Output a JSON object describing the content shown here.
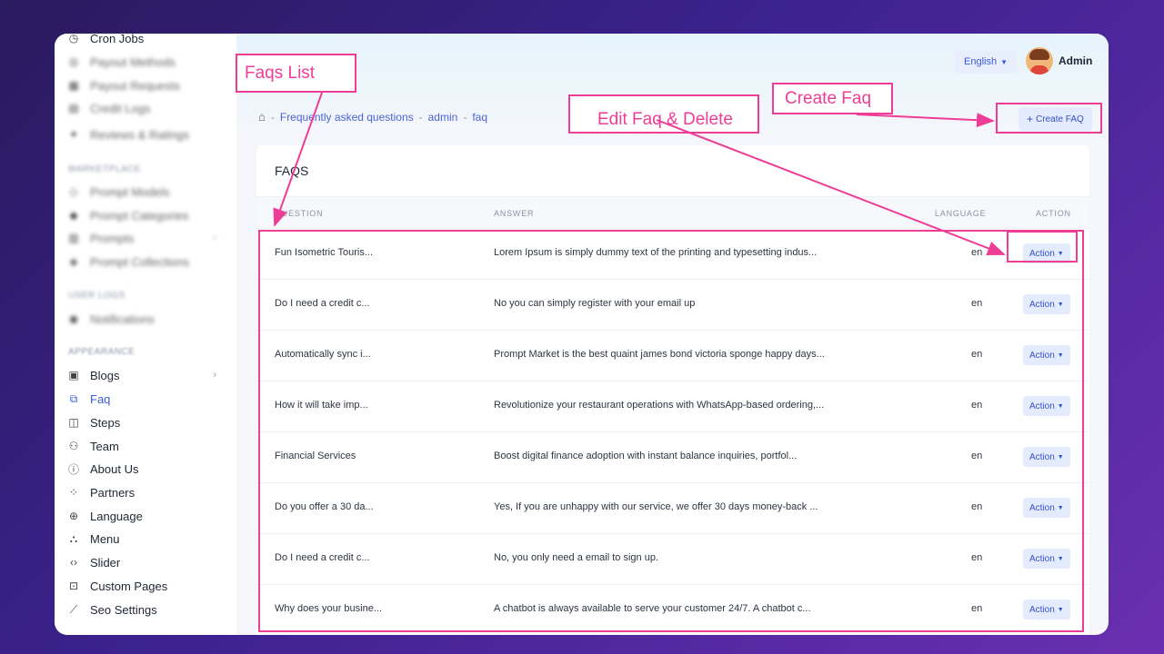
{
  "sidebar": {
    "items": [
      {
        "label": "Cron Jobs",
        "icon": "clock-icon"
      },
      {
        "label": "Payout Methods",
        "icon": "wallet-icon"
      },
      {
        "label": "Payout Requests",
        "icon": "receipt-icon"
      },
      {
        "label": "Credit Logs",
        "icon": "log-icon"
      },
      {
        "label": "Reviews & Ratings",
        "icon": "star-icon"
      },
      {
        "label": "Prompt Models",
        "icon": "model-icon"
      },
      {
        "label": "Prompt Categories",
        "icon": "category-icon"
      },
      {
        "label": "Prompts",
        "icon": "prompt-icon"
      },
      {
        "label": "Prompt Collections",
        "icon": "collection-icon"
      },
      {
        "label": "Notifications",
        "icon": "bell-icon"
      },
      {
        "label": "Blogs",
        "icon": "blog-icon"
      },
      {
        "label": "Faq",
        "icon": "faq-icon"
      },
      {
        "label": "Steps",
        "icon": "steps-icon"
      },
      {
        "label": "Team",
        "icon": "team-icon"
      },
      {
        "label": "About Us",
        "icon": "info-icon"
      },
      {
        "label": "Partners",
        "icon": "partners-icon"
      },
      {
        "label": "Language",
        "icon": "globe-icon"
      },
      {
        "label": "Menu",
        "icon": "menu-icon"
      },
      {
        "label": "Slider",
        "icon": "code-icon"
      },
      {
        "label": "Custom Pages",
        "icon": "page-icon"
      },
      {
        "label": "Seo Settings",
        "icon": "chart-icon"
      }
    ],
    "headings": {
      "marketplace": "MARKETPLACE",
      "user_logs": "USER LOGS",
      "appearance": "APPEARANCE"
    }
  },
  "header": {
    "language": "English",
    "admin_name": "Admin"
  },
  "breadcrumb": {
    "items": [
      "Frequently asked questions",
      "admin",
      "faq"
    ],
    "separator": "-"
  },
  "toolbar": {
    "create_label": "Create FAQ"
  },
  "card": {
    "title": "FAQS",
    "columns": {
      "question": "QUESTION",
      "answer": "ANSWER",
      "language": "LANGUAGE",
      "action": "ACTION"
    },
    "action_label": "Action",
    "rows": [
      {
        "question": "Fun Isometric Touris...",
        "answer": "Lorem Ipsum is simply dummy text of the printing and typesetting indus...",
        "language": "en"
      },
      {
        "question": "Do I need a credit c...",
        "answer": "No you can simply register with your email up",
        "language": "en"
      },
      {
        "question": "Automatically sync i...",
        "answer": "Prompt Market is the best quaint james bond victoria sponge happy days...",
        "language": "en"
      },
      {
        "question": "How it will take imp...",
        "answer": "Revolutionize your restaurant operations with WhatsApp-based ordering,...",
        "language": "en"
      },
      {
        "question": "Financial Services",
        "answer": "Boost digital finance adoption with instant balance inquiries, portfol...",
        "language": "en"
      },
      {
        "question": "Do you offer a 30 da...",
        "answer": "Yes, If you are unhappy with our service, we offer 30 days money-back ...",
        "language": "en"
      },
      {
        "question": "Do I need a credit c...",
        "answer": "No, you only need a email to sign up.",
        "language": "en"
      },
      {
        "question": "Why does your busine...",
        "answer": "A chatbot is always available to serve your customer 24/7. A chatbot c...",
        "language": "en"
      }
    ]
  },
  "annotations": {
    "faqs_list": "Faqs List",
    "create_faq": "Create Faq",
    "edit_delete": "Edit Faq & Delete",
    "color": "#ee3d96"
  }
}
